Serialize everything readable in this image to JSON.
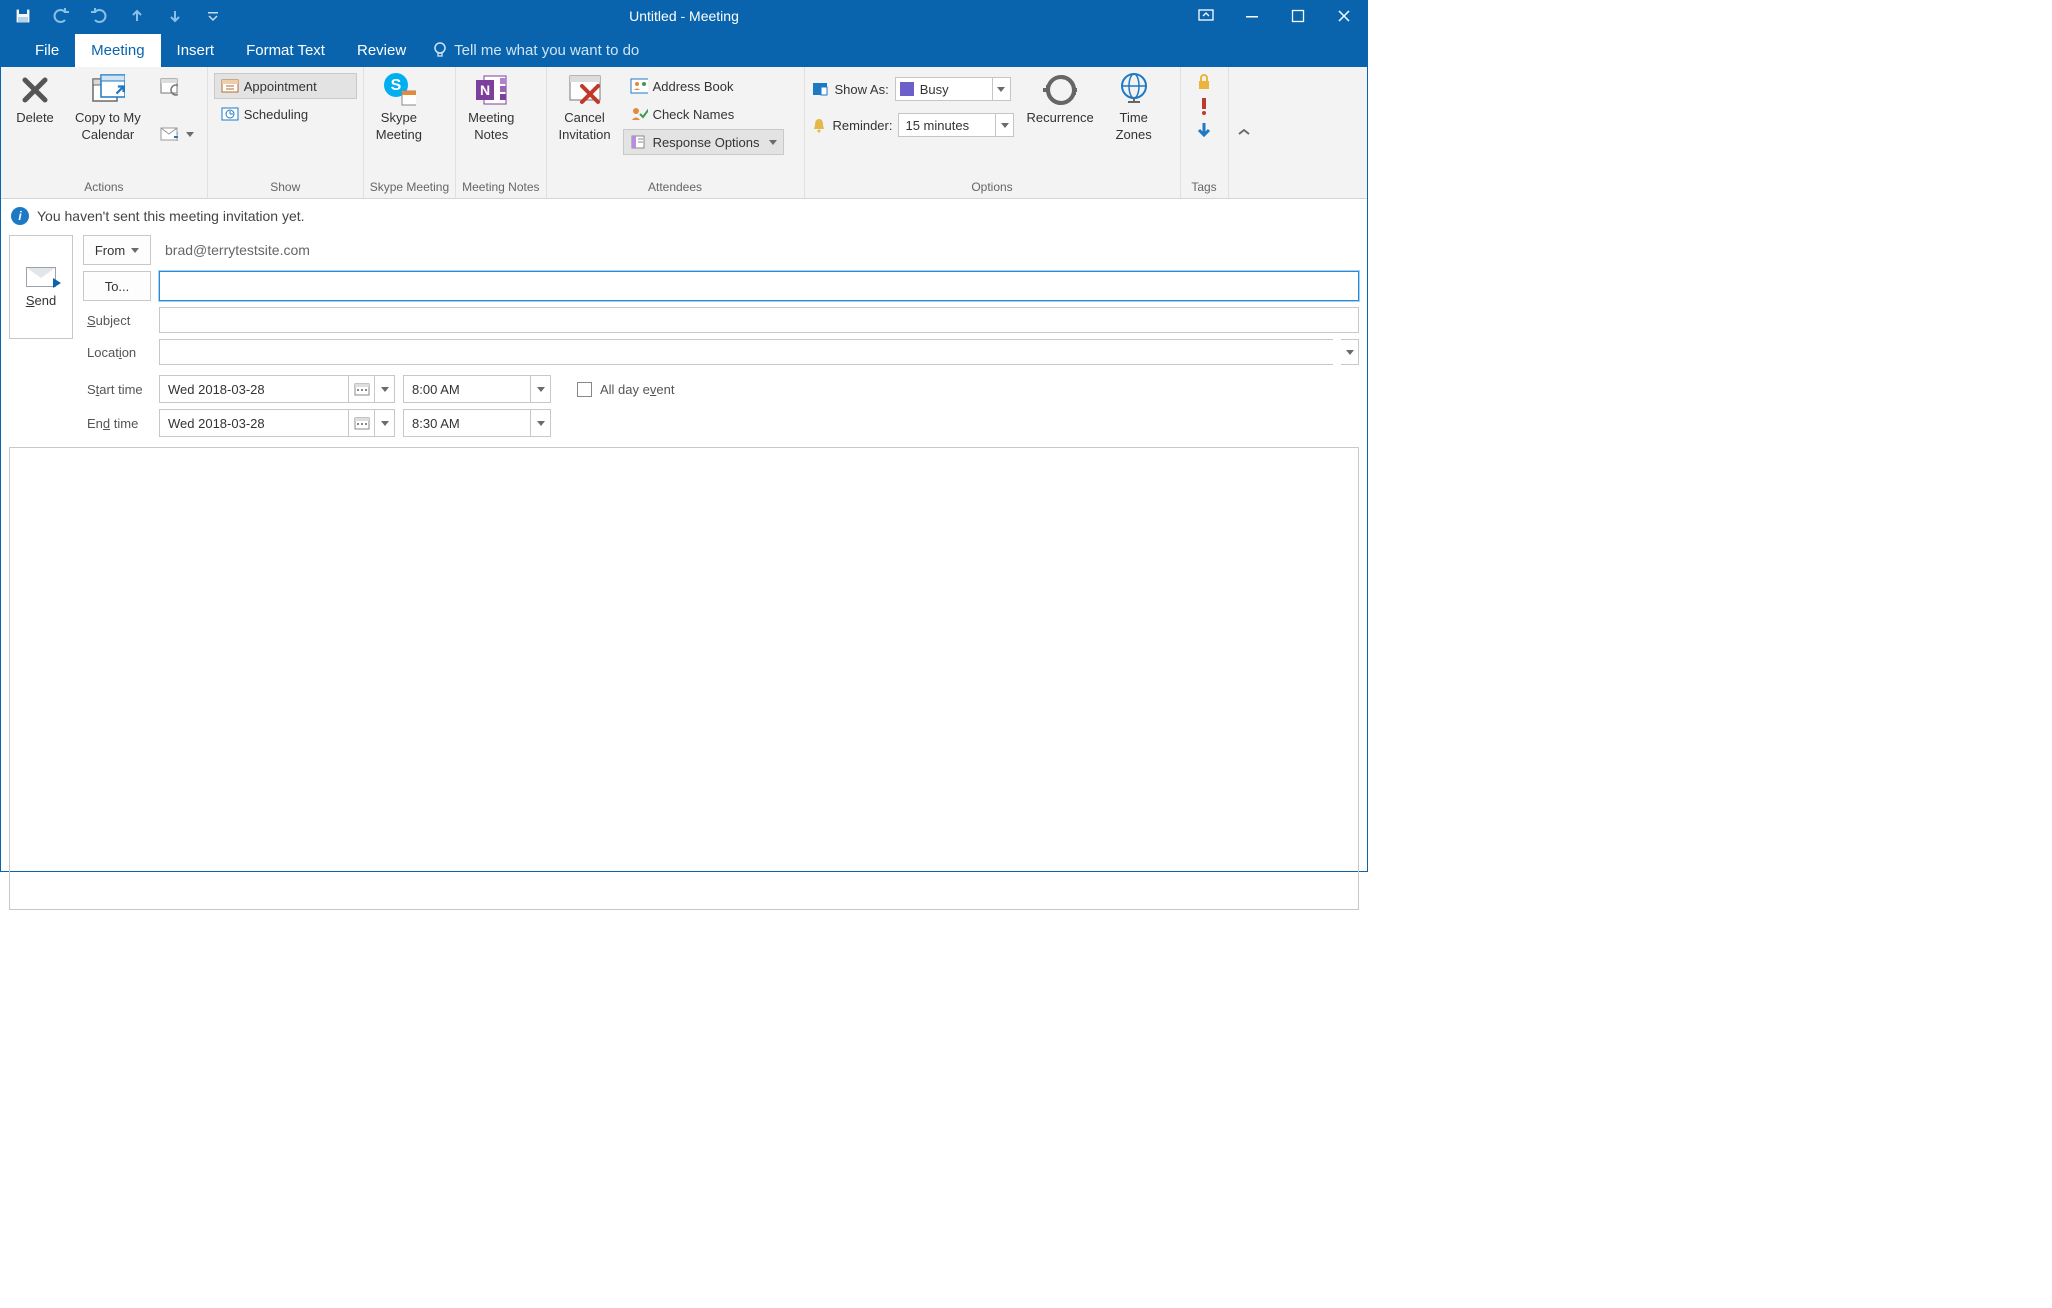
{
  "title": "Untitled  -  Meeting",
  "tabs": {
    "file": "File",
    "meeting": "Meeting",
    "insert": "Insert",
    "format": "Format Text",
    "review": "Review",
    "tellme": "Tell me what you want to do"
  },
  "ribbon": {
    "actions": {
      "label": "Actions",
      "delete": "Delete",
      "copy_line1": "Copy to My",
      "copy_line2": "Calendar"
    },
    "show": {
      "label": "Show",
      "appointment": "Appointment",
      "scheduling": "Scheduling"
    },
    "skype": {
      "label": "Skype Meeting",
      "btn_line1": "Skype",
      "btn_line2": "Meeting"
    },
    "notes": {
      "label": "Meeting Notes",
      "btn_line1": "Meeting",
      "btn_line2": "Notes"
    },
    "attendees": {
      "label": "Attendees",
      "cancel_line1": "Cancel",
      "cancel_line2": "Invitation",
      "address_book": "Address Book",
      "check_names": "Check Names",
      "response_options": "Response Options"
    },
    "options": {
      "label": "Options",
      "show_as": "Show As:",
      "show_as_value": "Busy",
      "reminder": "Reminder:",
      "reminder_value": "15 minutes",
      "recurrence": "Recurrence",
      "time_zones_line1": "Time",
      "time_zones_line2": "Zones"
    },
    "tags": {
      "label": "Tags"
    }
  },
  "info": "You haven't sent this meeting invitation yet.",
  "form": {
    "send": "Send",
    "from_label": "From",
    "from_value": "brad@terrytestsite.com",
    "to_label": "To...",
    "to_value": "",
    "subject_label": "Subject",
    "subject_value": "",
    "location_label": "Location",
    "location_value": "",
    "start_label": "Start time",
    "end_label": "End time",
    "start_date": "Wed 2018-03-28",
    "start_time": "8:00 AM",
    "end_date": "Wed 2018-03-28",
    "end_time": "8:30 AM",
    "all_day": "All day event"
  }
}
